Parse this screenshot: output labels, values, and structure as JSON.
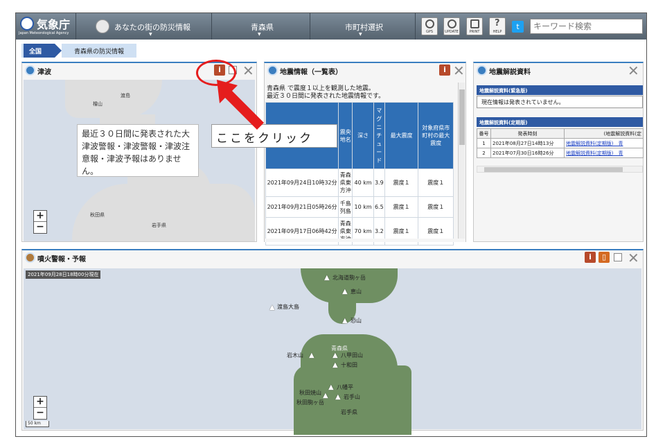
{
  "header": {
    "logo_text": "気象庁",
    "logo_sub": "Japan Meteorological Agency",
    "nav": [
      "あなたの街の防災情報",
      "青森県",
      "市町村選択"
    ],
    "tools": [
      "GPS",
      "UPDATE",
      "PRINT",
      "HELP"
    ],
    "twitter": "t",
    "search_placeholder": "キーワード検索"
  },
  "breadcrumb": [
    "全国",
    "青森県の防災情報"
  ],
  "tsunami": {
    "title": "津波",
    "callout": "最近３０日間に発表された大津波警報・津波警報・津波注意報・津波予報はありません。",
    "click_note": "ここをクリック",
    "map_labels": [
      "渡島",
      "檜山",
      "秋田県",
      "岩手県"
    ]
  },
  "quake": {
    "title": "地震情報（一覧表）",
    "description": "青森県 で震度１以上を観測した地震。\n最近３０日間に発表された地震情報です。",
    "columns": [
      "",
      "震央地名",
      "深さ",
      "マグニチュード",
      "最大震度",
      "対象府県市町村の最大震度"
    ],
    "rows": [
      [
        "2021年09月24日10時32分",
        "青森県東方沖",
        "40 km",
        "3.9",
        "震度１",
        "震度１"
      ],
      [
        "2021年09月21日05時26分",
        "千島列島",
        "10 km",
        "6.5",
        "震度１",
        "震度１"
      ],
      [
        "2021年09月17日06時42分",
        "青森県東方沖",
        "70 km",
        "3.2",
        "震度１",
        "震度１"
      ]
    ]
  },
  "docs": {
    "title": "地震解説資料",
    "urgent_header": "地震解説資料(緊急版)",
    "urgent_text": "現在情報は発表されていません。",
    "regular_header": "地震解説資料(定期版)",
    "table_cols": [
      "番号",
      "発表時刻",
      "(地震解説資料(定"
    ],
    "table_rows": [
      [
        "1",
        "2021年08月27日14時13分",
        "地震解説資料(定期版)　青"
      ],
      [
        "2",
        "2021年07月30日16時26分",
        "地震解説資料(定期版)　青"
      ]
    ]
  },
  "volcano": {
    "title": "噴火警報・予報",
    "timestamp": "2021年09月28日18時00分現在",
    "scale": "50 km",
    "volcanoes": [
      "北海道駒ヶ岳",
      "恵山",
      "渡島大島",
      "恐山",
      "岩木山",
      "八甲田山",
      "十和田",
      "八幡平",
      "秋田焼山",
      "岩手山",
      "秋田駒ヶ岳"
    ],
    "map_labels": [
      "青森県",
      "岩手県"
    ]
  }
}
